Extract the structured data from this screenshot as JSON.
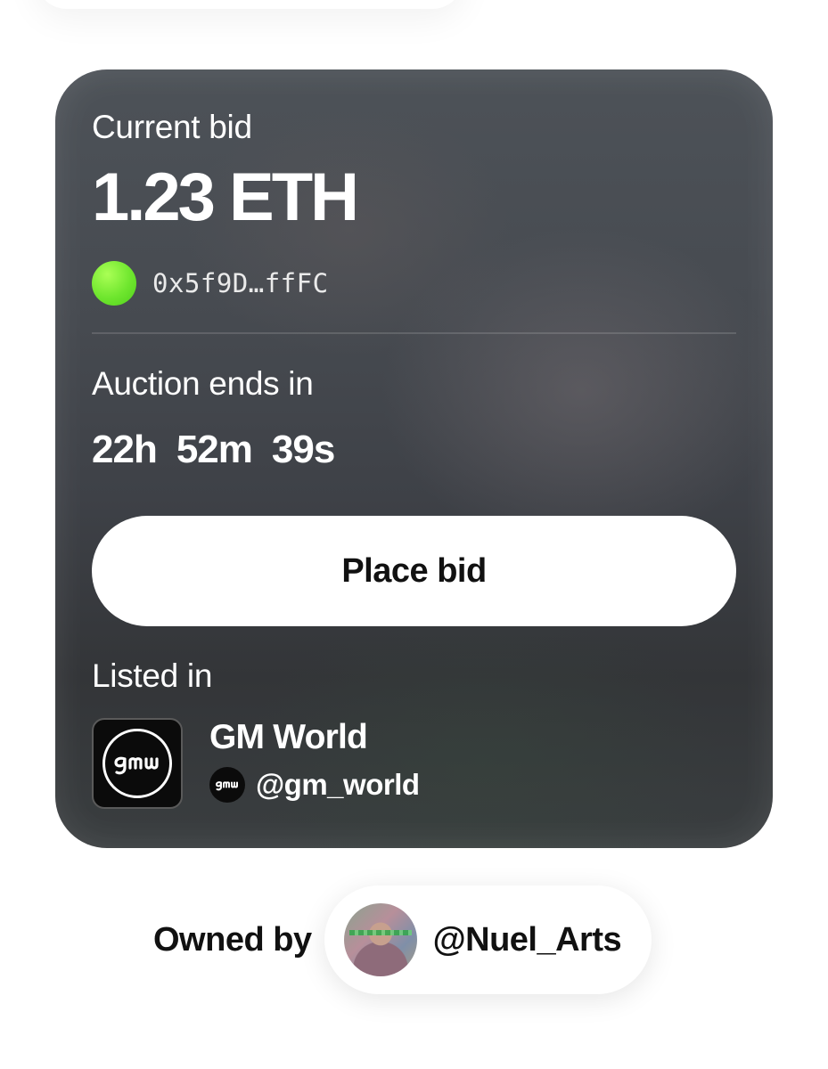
{
  "auction": {
    "current_bid_label": "Current bid",
    "current_bid_amount": "1.23 ETH",
    "bidder_address": "0x5f9D…ffFC",
    "bidder_avatar_color": "#7cf03a",
    "ends_label": "Auction ends in",
    "countdown": {
      "hours": "22h",
      "minutes": "52m",
      "seconds": "39s"
    },
    "place_bid_label": "Place bid"
  },
  "listing": {
    "listed_in_label": "Listed in",
    "collection_name": "GM World",
    "collection_handle": "@gm_world",
    "logo_text": "gmw"
  },
  "owner": {
    "owned_by_label": "Owned by",
    "owner_handle": "@Nuel_Arts"
  }
}
